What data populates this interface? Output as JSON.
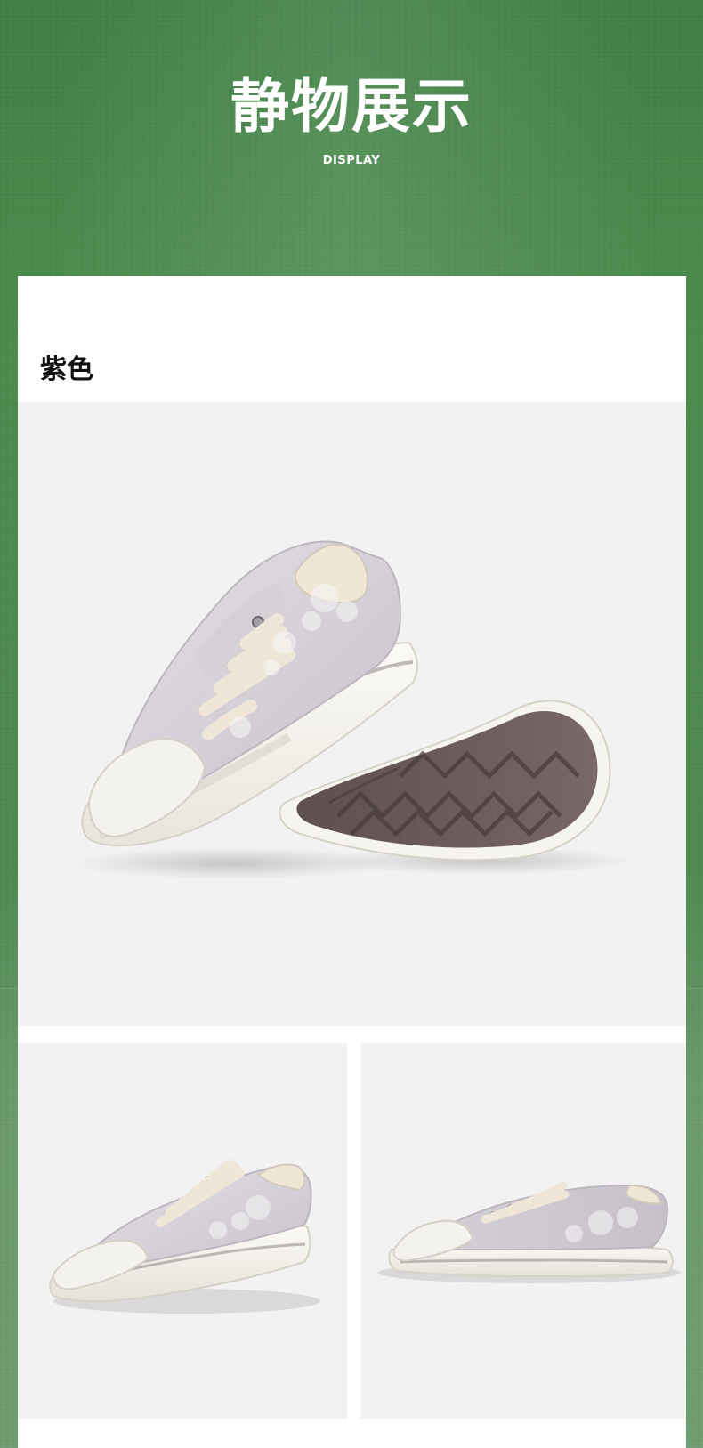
{
  "header": {
    "title": "静物展示",
    "subtitle": "DISPLAY"
  },
  "section": {
    "color_label": "紫色"
  },
  "gallery": {
    "images": [
      {
        "name": "hero",
        "icon": "sneaker-pair-photo"
      },
      {
        "name": "thumb-left",
        "icon": "sneaker-angled-photo"
      },
      {
        "name": "thumb-right",
        "icon": "sneaker-side-photo"
      }
    ]
  },
  "colors": {
    "background_green": "#4b8a4d",
    "card": "#ffffff",
    "photo_bg": "#f2f2f2",
    "upper_lavender": "#d6d1d7",
    "sole_cream": "#f2efe7",
    "outsole_brown": "#6a5a5a"
  }
}
